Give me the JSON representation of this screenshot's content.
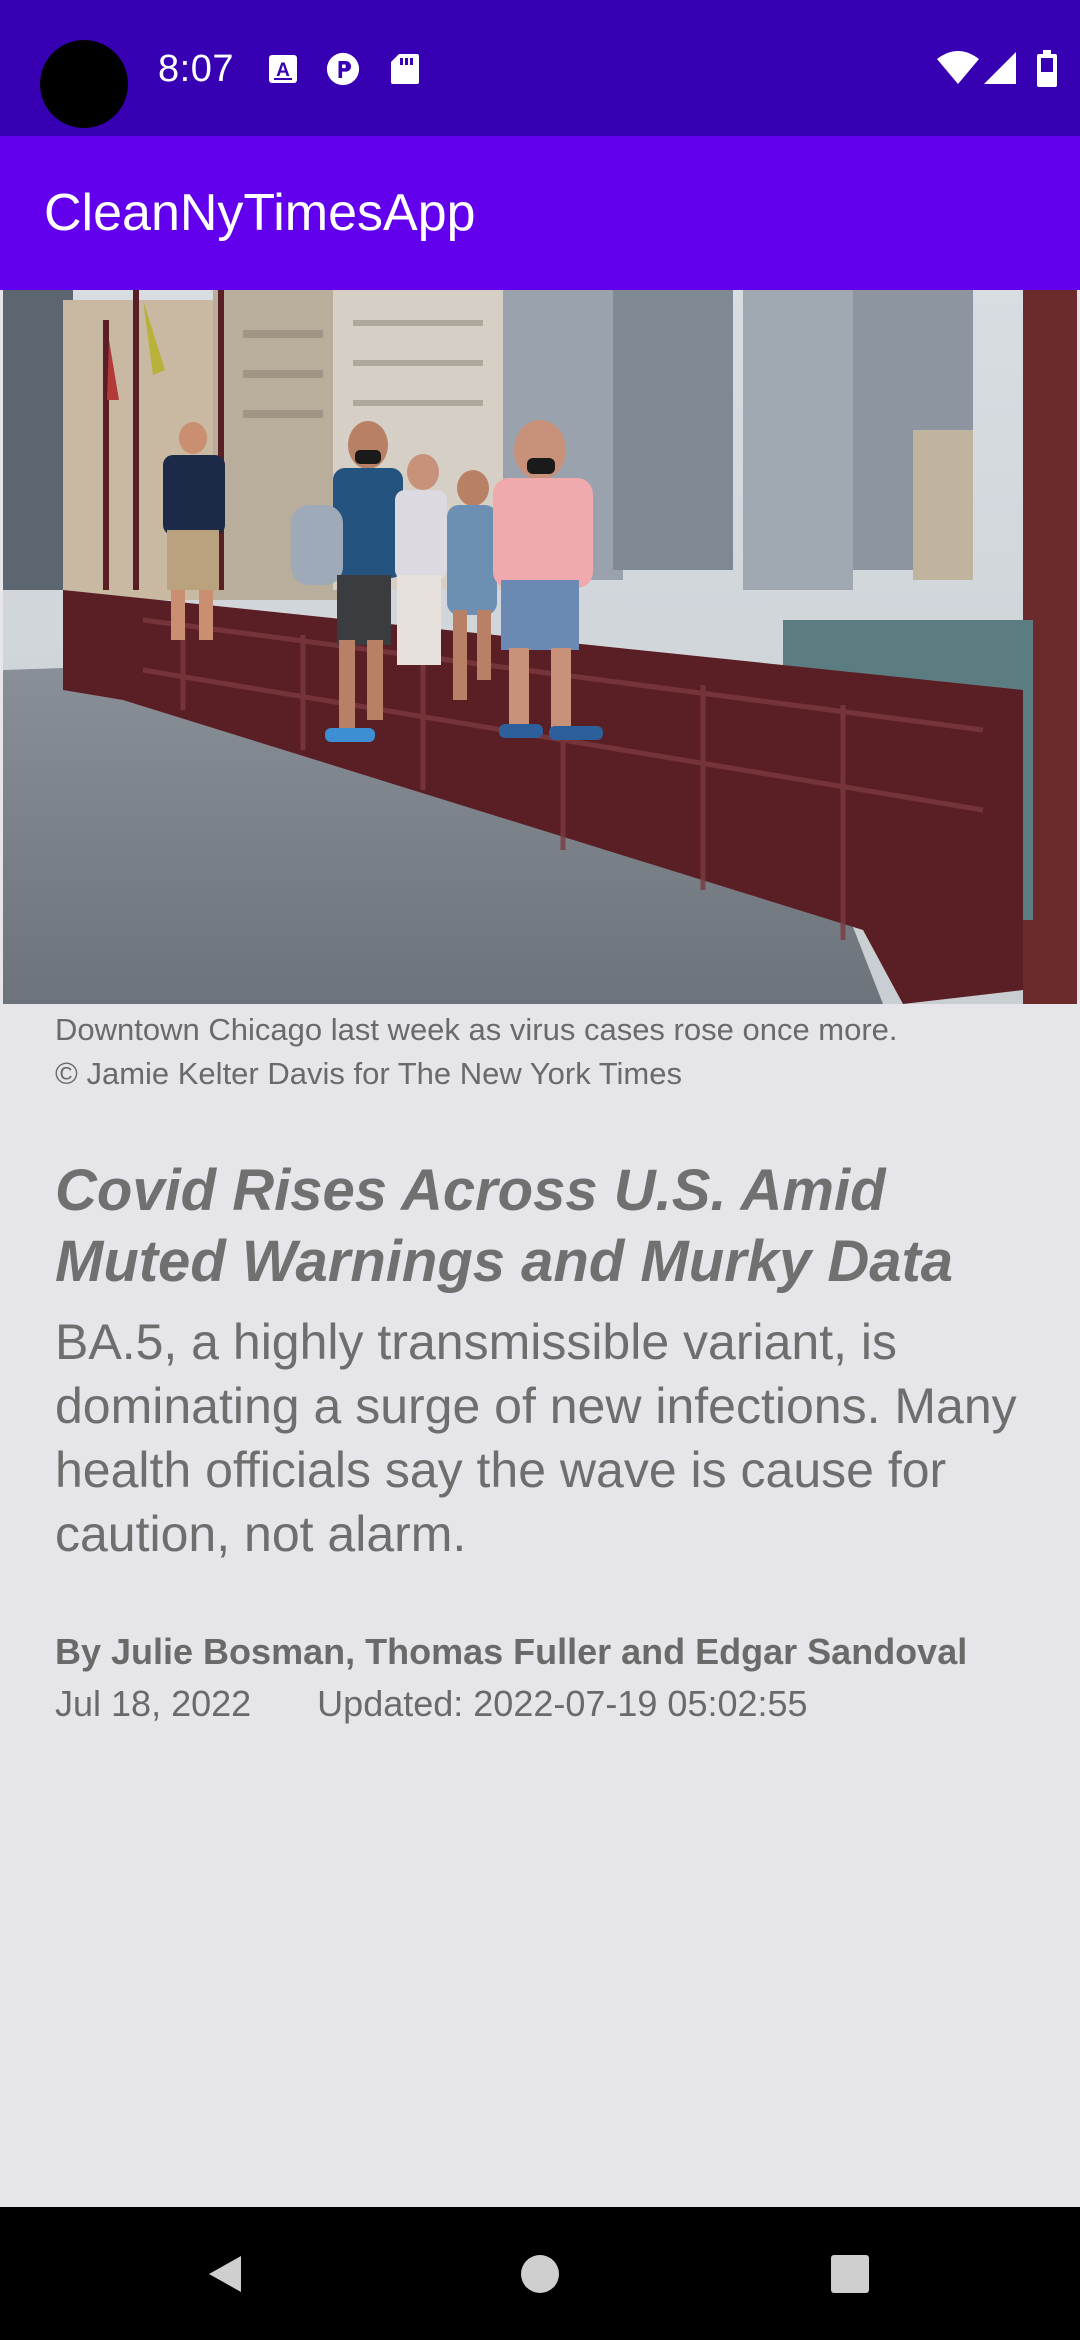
{
  "status_bar": {
    "time": "8:07",
    "left_icons": [
      "a-notification-icon",
      "p-notification-icon",
      "sd-card-icon"
    ],
    "right_icons": [
      "wifi-icon",
      "signal-icon",
      "battery-icon"
    ],
    "background": "#3700b3"
  },
  "app_bar": {
    "title": "CleanNyTimesApp",
    "background": "#6200ee"
  },
  "article": {
    "image_alt": "People wearing masks on a bridge in downtown Chicago",
    "caption_line1": "Downtown Chicago last week as virus cases rose once more.",
    "caption_line2": "© Jamie Kelter Davis for The New York Times",
    "headline": "Covid Rises Across U.S. Amid Muted Warnings and Murky Data",
    "summary": "BA.5, a highly transmissible variant, is dominating a surge of new infections. Many health officials say the wave is cause for caution, not alarm.",
    "byline": "By Julie Bosman, Thomas Fuller and Edgar Sandoval",
    "published_date": "Jul 18, 2022",
    "updated": "Updated: 2022-07-19 05:02:55"
  },
  "nav_bar": {
    "buttons": [
      "back-icon",
      "home-icon",
      "recents-icon"
    ]
  }
}
